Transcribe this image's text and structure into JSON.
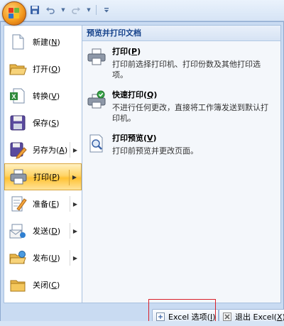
{
  "left_menu": {
    "items": [
      {
        "label": "新建(",
        "key": "N",
        "tail": ")"
      },
      {
        "label": "打开(",
        "key": "O",
        "tail": ")"
      },
      {
        "label": "转换(",
        "key": "V",
        "tail": ")"
      },
      {
        "label": "保存(",
        "key": "S",
        "tail": ")"
      },
      {
        "label": "另存为(",
        "key": "A",
        "tail": ")"
      },
      {
        "label": "打印(",
        "key": "P",
        "tail": ")"
      },
      {
        "label": "准备(",
        "key": "E",
        "tail": ")"
      },
      {
        "label": "发送(",
        "key": "D",
        "tail": ")"
      },
      {
        "label": "发布(",
        "key": "U",
        "tail": ")"
      },
      {
        "label": "关闭(",
        "key": "C",
        "tail": ")"
      }
    ],
    "active_index": 5
  },
  "panel": {
    "heading": "预览并打印文档",
    "items": [
      {
        "title": "打印(",
        "key": "P",
        "tail": ")",
        "desc": "打印前选择打印机、打印份数及其他打印选项。"
      },
      {
        "title": "快速打印(",
        "key": "Q",
        "tail": ")",
        "desc": "不进行任何更改，直接将工作簿发送到默认打印机。"
      },
      {
        "title": "打印预览(",
        "key": "V",
        "tail": ")",
        "desc": "打印前预览并更改页面。"
      }
    ]
  },
  "bottom": {
    "options_label": "Excel 选项(",
    "options_key": "I",
    "options_tail": ")",
    "exit_label": "退出 Excel(",
    "exit_key": "X",
    "exit_tail": ")"
  },
  "colors": {
    "accent": "#ffc234",
    "frame": "#c9dbf2",
    "highlight_border": "#d9202a"
  }
}
